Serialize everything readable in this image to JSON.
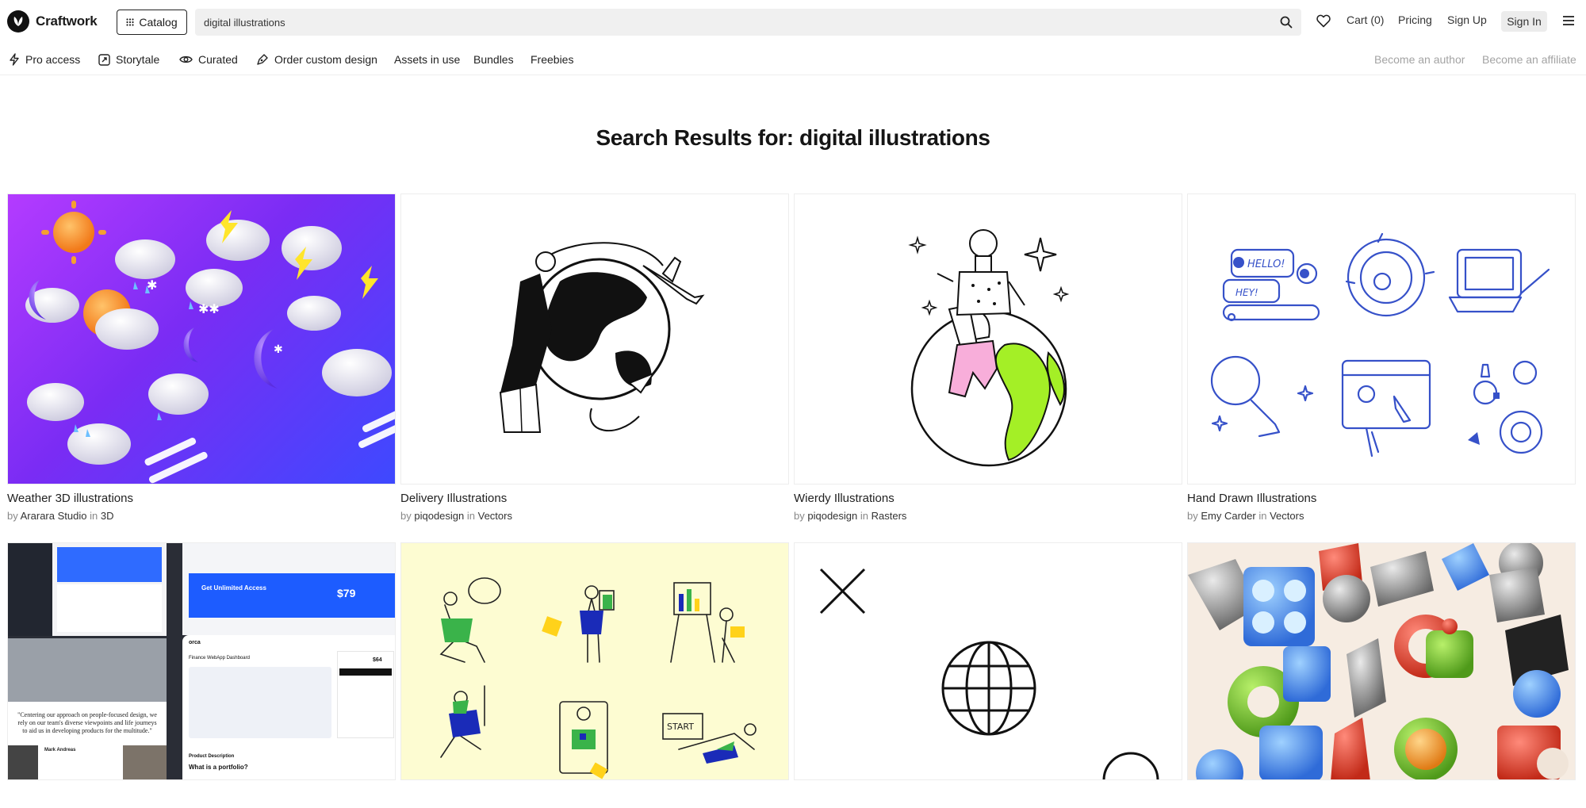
{
  "header": {
    "logo_text": "Craftwork",
    "catalog_label": "Catalog",
    "search_value": "digital illustrations",
    "cart_label": "Cart (0)",
    "pricing_label": "Pricing",
    "signup_label": "Sign Up",
    "signin_label": "Sign In"
  },
  "subnav": {
    "items": [
      {
        "label": "Pro access",
        "icon": "bolt-icon"
      },
      {
        "label": "Storytale",
        "icon": "storytale-icon"
      },
      {
        "label": "Curated",
        "icon": "eye-icon"
      },
      {
        "label": "Order custom design",
        "icon": "pen-icon"
      },
      {
        "label": "Assets in use"
      },
      {
        "label": "Bundles"
      },
      {
        "label": "Freebies"
      }
    ],
    "become_author": "Become an author",
    "become_affiliate": "Become an affiliate"
  },
  "results_title": "Search Results for: digital illustrations",
  "products": [
    {
      "title": "Weather 3D illustrations",
      "by": "by",
      "author": "Ararara Studio",
      "in": "in",
      "category": "3D"
    },
    {
      "title": "Delivery Illustrations",
      "by": "by",
      "author": "piqodesign",
      "in": "in",
      "category": "Vectors"
    },
    {
      "title": "Wierdy Illustrations",
      "by": "by",
      "author": "piqodesign",
      "in": "in",
      "category": "Rasters"
    },
    {
      "title": "Hand Drawn Illustrations",
      "by": "by",
      "author": "Emy Carder",
      "in": "in",
      "category": "Vectors"
    }
  ],
  "row2": {
    "portfolio_quote": "\"Centering our approach on people-focused design, we rely on our team's diverse viewpoints and life journeys to aid us in developing products for the multitude.\"",
    "portfolio_person": "Mark Andreas",
    "dashboard_banner": "Get Unlimited Access",
    "dashboard_price": "$79",
    "dashboard_side_price": "$64",
    "dashboard_logo": "orca",
    "dashboard_title": "Finance WebApp Dashboard",
    "dashboard_desc_label": "Product Description",
    "dashboard_question": "What is a portfolio?",
    "start_label": "START"
  },
  "colors": {
    "accent_blue": "#2f6bff",
    "weather_purple": "#7b2ff0",
    "yellow_bg": "#fdfcd2",
    "green": "#9be22d"
  }
}
